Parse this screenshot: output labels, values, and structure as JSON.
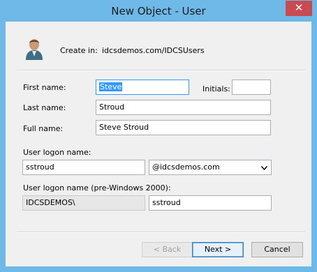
{
  "window": {
    "title": "New Object - User",
    "close_glyph": "✕"
  },
  "header": {
    "create_in_label": "Create in:",
    "create_in_path": "idcsdemos.com/IDCSUsers",
    "icon": "user-icon"
  },
  "form": {
    "first_name_label": "First name:",
    "first_name_value": "Steve",
    "initials_label": "Initials:",
    "initials_value": "",
    "last_name_label": "Last name:",
    "last_name_value": "Stroud",
    "full_name_label": "Full name:",
    "full_name_value": "Steve Stroud",
    "logon_name_label": "User logon name:",
    "logon_name_value": "sstroud",
    "domain_value": "@idcsdemos.com",
    "pre2000_label": "User logon name (pre-Windows 2000):",
    "pre2000_domain_value": "IDCSDEMOS\\",
    "pre2000_name_value": "sstroud"
  },
  "buttons": {
    "back_label": "< Back",
    "next_label": "Next >",
    "cancel_label": "Cancel"
  },
  "colors": {
    "frame": "#6fb9e9",
    "close": "#c74b50",
    "client": "#f0f0f0",
    "selection": "#3399ff"
  }
}
